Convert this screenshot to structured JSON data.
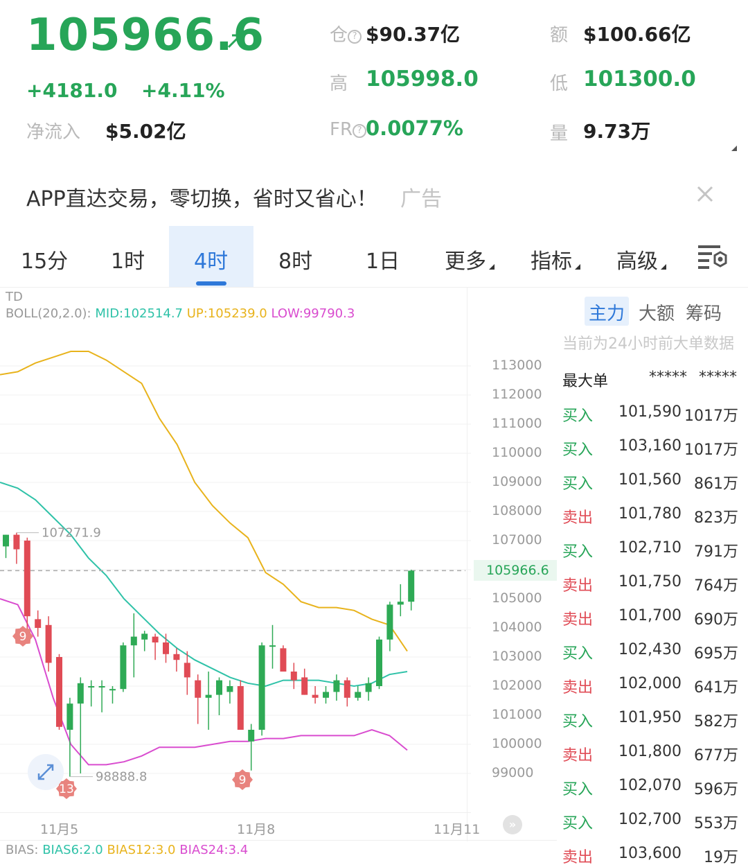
{
  "header": {
    "price": "105966.6",
    "change": "+4181.0",
    "change_pct": "+4.11%",
    "net_inflow_label": "净流入",
    "net_inflow_value": "$5.02亿",
    "open_interest_label": "仓",
    "open_interest_value": "$90.37亿",
    "high_label": "高",
    "high_value": "105998.0",
    "funding_label": "FR",
    "funding_value": "0.0077%",
    "amount_label": "额",
    "amount_value": "$100.66亿",
    "low_label": "低",
    "low_value": "101300.0",
    "volume_label": "量",
    "volume_value": "9.73万",
    "colors": {
      "up": "#27a558",
      "down": "#e04b55",
      "accent": "#2e78d9"
    }
  },
  "ad": {
    "text": "APP直达交易，零切换，省时又省心！",
    "tag": "广告"
  },
  "tabs": [
    {
      "label": "15分"
    },
    {
      "label": "1时"
    },
    {
      "label": "4时",
      "active": true
    },
    {
      "label": "8时"
    },
    {
      "label": "1日"
    },
    {
      "label": "更多"
    },
    {
      "label": "指标"
    },
    {
      "label": "高级"
    }
  ],
  "chart": {
    "indicator_td": "TD",
    "boll_prefix": "BOLL(20,2.0):",
    "boll_mid": "MID:102514.7",
    "boll_up": "UP:105239.0",
    "boll_low": "LOW:99790.3",
    "bias_prefix": "BIAS:",
    "bias6": "BIAS6:2.0",
    "bias12": "BIAS12:3.0",
    "bias24": "BIAS24:3.4",
    "high_marker": "107271.9",
    "low_marker": "98888.8",
    "current_price": "105966.6",
    "td_markers": [
      "9",
      "13",
      "9"
    ],
    "x_labels": [
      "11月5",
      "11月8",
      "11月11"
    ],
    "y_labels": [
      "113000",
      "112000",
      "111000",
      "110000",
      "109000",
      "108000",
      "107000",
      "105000",
      "104000",
      "103000",
      "102000",
      "101000",
      "100000",
      "99000"
    ]
  },
  "chart_data": {
    "type": "candlestick",
    "y_range": [
      98500,
      113500
    ],
    "last_price": 105966.6,
    "bollinger": {
      "mid": 102514.7,
      "up": 105239.0,
      "low": 99790.3
    },
    "bias": {
      "bias6": 2.0,
      "bias12": 3.0,
      "bias24": 3.4
    },
    "candles": [
      {
        "o": 106800,
        "h": 107200,
        "l": 106400,
        "c": 107200
      },
      {
        "o": 107200,
        "h": 107271.9,
        "l": 106200,
        "c": 106700
      },
      {
        "o": 107000,
        "h": 107100,
        "l": 103900,
        "c": 104400
      },
      {
        "o": 104300,
        "h": 104600,
        "l": 103700,
        "c": 104000
      },
      {
        "o": 104100,
        "h": 104400,
        "l": 102500,
        "c": 102800
      },
      {
        "o": 103000,
        "h": 103100,
        "l": 100500,
        "c": 100600
      },
      {
        "o": 100500,
        "h": 101600,
        "l": 98888.8,
        "c": 101400
      },
      {
        "o": 101400,
        "h": 102300,
        "l": 99000,
        "c": 102100
      },
      {
        "o": 102000,
        "h": 102200,
        "l": 101300,
        "c": 102000
      },
      {
        "o": 102000,
        "h": 102200,
        "l": 101100,
        "c": 102000
      },
      {
        "o": 101900,
        "h": 102000,
        "l": 101400,
        "c": 101900
      },
      {
        "o": 101900,
        "h": 103500,
        "l": 101800,
        "c": 103400
      },
      {
        "o": 103400,
        "h": 104500,
        "l": 102300,
        "c": 103700
      },
      {
        "o": 103600,
        "h": 103900,
        "l": 103200,
        "c": 103800
      },
      {
        "o": 103700,
        "h": 103800,
        "l": 102900,
        "c": 103500
      },
      {
        "o": 103500,
        "h": 103800,
        "l": 102800,
        "c": 103100
      },
      {
        "o": 103100,
        "h": 103300,
        "l": 102500,
        "c": 102900
      },
      {
        "o": 102800,
        "h": 103200,
        "l": 101700,
        "c": 102300
      },
      {
        "o": 102200,
        "h": 102400,
        "l": 100700,
        "c": 101600
      },
      {
        "o": 101600,
        "h": 102500,
        "l": 100500,
        "c": 101700
      },
      {
        "o": 101700,
        "h": 102300,
        "l": 101000,
        "c": 102200
      },
      {
        "o": 101800,
        "h": 102200,
        "l": 101400,
        "c": 102000
      },
      {
        "o": 102000,
        "h": 102200,
        "l": 100500,
        "c": 100500
      },
      {
        "o": 100100,
        "h": 100700,
        "l": 99100,
        "c": 100500
      },
      {
        "o": 100500,
        "h": 103500,
        "l": 100300,
        "c": 103400
      },
      {
        "o": 103400,
        "h": 104100,
        "l": 102600,
        "c": 103400
      },
      {
        "o": 103300,
        "h": 103400,
        "l": 102500,
        "c": 102500
      },
      {
        "o": 102500,
        "h": 102800,
        "l": 101900,
        "c": 102200
      },
      {
        "o": 102300,
        "h": 102600,
        "l": 101700,
        "c": 101700
      },
      {
        "o": 101700,
        "h": 102000,
        "l": 101400,
        "c": 101600
      },
      {
        "o": 101600,
        "h": 102000,
        "l": 101400,
        "c": 101800
      },
      {
        "o": 101800,
        "h": 102400,
        "l": 101500,
        "c": 102200
      },
      {
        "o": 102200,
        "h": 102300,
        "l": 101300,
        "c": 101600
      },
      {
        "o": 101600,
        "h": 102000,
        "l": 101500,
        "c": 101800
      },
      {
        "o": 101800,
        "h": 102300,
        "l": 101500,
        "c": 102100
      },
      {
        "o": 102000,
        "h": 103700,
        "l": 101900,
        "c": 103600
      },
      {
        "o": 103600,
        "h": 104900,
        "l": 103200,
        "c": 104800
      },
      {
        "o": 104800,
        "h": 105500,
        "l": 104400,
        "c": 104900
      },
      {
        "o": 104900,
        "h": 105998.0,
        "l": 104600,
        "c": 105966.6
      }
    ],
    "boll_up_series": [
      112700,
      112800,
      113100,
      113300,
      113500,
      113500,
      113200,
      112800,
      112400,
      111200,
      110300,
      109000,
      108200,
      107600,
      107100,
      105900,
      105500,
      104900,
      104700,
      104700,
      104600,
      104300,
      104100,
      103200
    ],
    "boll_mid_series": [
      109000,
      108800,
      108400,
      107800,
      107200,
      106400,
      105800,
      105000,
      104400,
      103800,
      103300,
      102900,
      102600,
      102300,
      102100,
      102000,
      102200,
      102200,
      102200,
      102100,
      102000,
      102100,
      102400,
      102500
    ],
    "boll_low_series": [
      105000,
      104800,
      103600,
      101600,
      100000,
      99300,
      99300,
      99400,
      99600,
      99900,
      99900,
      99900,
      100000,
      100100,
      100100,
      100200,
      100200,
      100300,
      100300,
      100300,
      100300,
      100500,
      100300,
      99800
    ]
  },
  "right_panel": {
    "tabs": [
      "主力",
      "大额",
      "筹码"
    ],
    "note": "当前为24小时前大单数据",
    "header": {
      "label": "最大单",
      "col1": "*****",
      "col2": "*****"
    },
    "rows": [
      {
        "side": "买入",
        "type": "buy",
        "price": "101,590",
        "amount": "1017万"
      },
      {
        "side": "买入",
        "type": "buy",
        "price": "103,160",
        "amount": "1017万"
      },
      {
        "side": "买入",
        "type": "buy",
        "price": "101,560",
        "amount": "861万"
      },
      {
        "side": "卖出",
        "type": "sell",
        "price": "101,780",
        "amount": "823万"
      },
      {
        "side": "买入",
        "type": "buy",
        "price": "102,710",
        "amount": "791万"
      },
      {
        "side": "卖出",
        "type": "sell",
        "price": "101,750",
        "amount": "764万"
      },
      {
        "side": "卖出",
        "type": "sell",
        "price": "101,700",
        "amount": "690万"
      },
      {
        "side": "买入",
        "type": "buy",
        "price": "102,430",
        "amount": "695万"
      },
      {
        "side": "卖出",
        "type": "sell",
        "price": "102,000",
        "amount": "641万"
      },
      {
        "side": "买入",
        "type": "buy",
        "price": "101,950",
        "amount": "582万"
      },
      {
        "side": "卖出",
        "type": "sell",
        "price": "101,800",
        "amount": "677万"
      },
      {
        "side": "买入",
        "type": "buy",
        "price": "102,070",
        "amount": "596万"
      },
      {
        "side": "买入",
        "type": "buy",
        "price": "102,700",
        "amount": "553万"
      },
      {
        "side": "卖出",
        "type": "sell",
        "price": "103,600",
        "amount": "19万"
      }
    ]
  }
}
